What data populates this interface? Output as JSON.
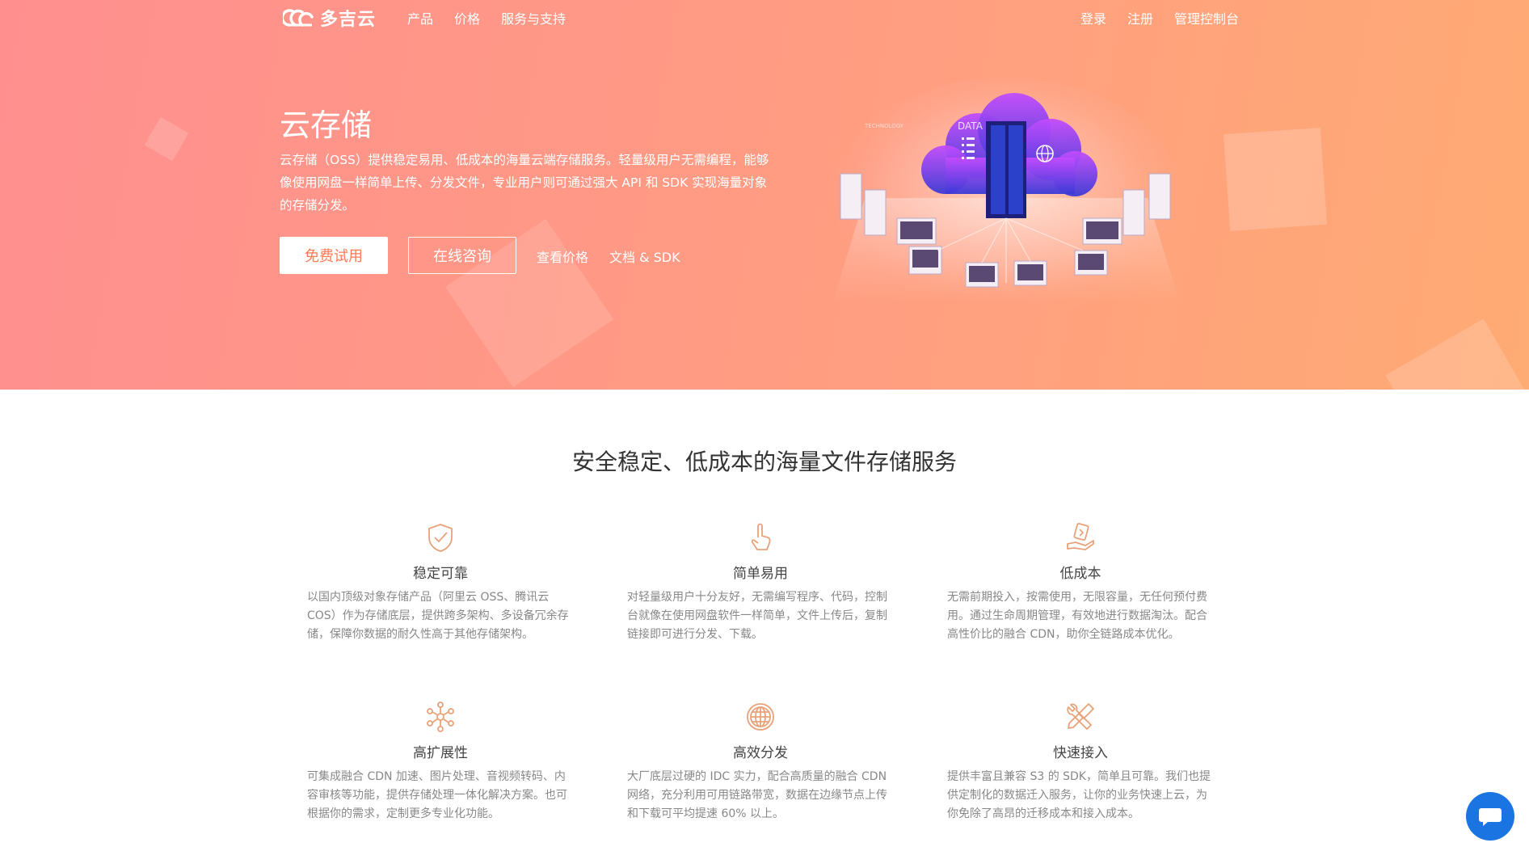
{
  "brand": {
    "name": "多吉云",
    "accent": "#ff8f73",
    "hero_gradient_start": "#ff8f8f",
    "hero_gradient_end": "#ffab74",
    "icon_color": "#e8a27a"
  },
  "nav": {
    "items": [
      "产品",
      "价格",
      "服务与支持"
    ],
    "right": [
      "登录",
      "注册",
      "管理控制台"
    ]
  },
  "hero": {
    "title": "云存储",
    "description": "云存储（OSS）提供稳定易用、低成本的海量云端存储服务。轻量级用户无需编程，能够像使用网盘一样简单上传、分发文件，专业用户则可通过强大 API 和 SDK 实现海量对象的存储分发。",
    "btn_trial": "免费试用",
    "btn_consult": "在线咨询",
    "link_pricing": "查看价格",
    "link_docs": "文档 & SDK",
    "illustration_label": "DATA",
    "illustration_sub": "TECHNOLOGY"
  },
  "section": {
    "title": "安全稳定、低成本的海量文件存储服务",
    "features": [
      {
        "icon": "shield-icon",
        "title": "稳定可靠",
        "desc": "以国内顶级对象存储产品（阿里云 OSS、腾讯云 COS）作为存储底层，提供跨多架构、多设备冗余存储，保障你数据的耐久性高于其他存储架构。"
      },
      {
        "icon": "hand-pointer-icon",
        "title": "简单易用",
        "desc": "对轻量级用户十分友好，无需编写程序、代码，控制台就像在使用网盘软件一样简单，文件上传后，复制链接即可进行分发、下载。"
      },
      {
        "icon": "hand-coin-icon",
        "title": "低成本",
        "desc": "无需前期投入，按需使用，无限容量，无任何预付费用。通过生命周期管理，有效地进行数据淘汰。配合高性价比的融合 CDN，助你全链路成本优化。"
      },
      {
        "icon": "network-nodes-icon",
        "title": "高扩展性",
        "desc": "可集成融合 CDN 加速、图片处理、音视频转码、内容审核等功能，提供存储处理一体化解决方案。也可根据你的需求，定制更多专业化功能。"
      },
      {
        "icon": "globe-icon",
        "title": "高效分发",
        "desc": "大厂底层过硬的 IDC 实力，配合高质量的融合 CDN 网络，充分利用可用链路带宽，数据在边缘节点上传和下载可平均提速 60% 以上。"
      },
      {
        "icon": "tools-icon",
        "title": "快速接入",
        "desc": "提供丰富且兼容 S3 的 SDK，简单且可靠。我们也提供定制化的数据迁入服务，让你的业务快速上云，为你免除了高昂的迁移成本和接入成本。"
      }
    ]
  },
  "chat": {
    "icon": "chat-bubble-icon",
    "color": "#1a74e2"
  }
}
